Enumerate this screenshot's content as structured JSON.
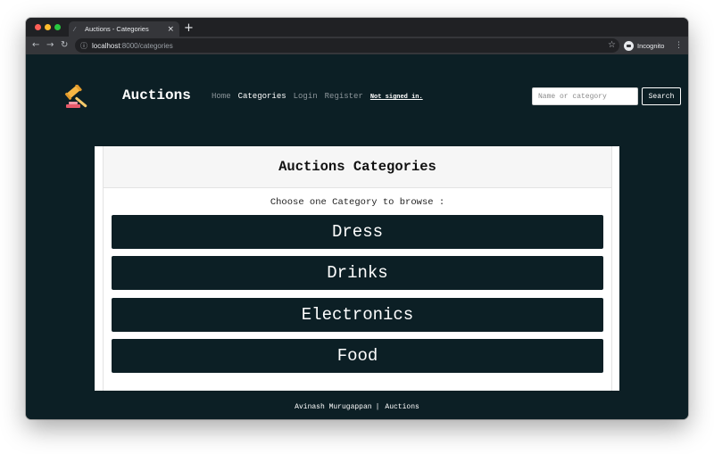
{
  "browser": {
    "tab_title": "Auctions - Categories",
    "tab_favicon": "⁄",
    "tab_close": "×",
    "new_tab": "+",
    "url_host": "localhost",
    "url_path": ":8000/categories",
    "profile_label": "Incognito"
  },
  "icons": {
    "back": "←",
    "forward": "→",
    "reload": "↻",
    "info": "ⓘ",
    "star": "☆",
    "menu": "⋮"
  },
  "header": {
    "brand": "Auctions",
    "nav": {
      "home": "Home",
      "categories": "Categories",
      "login": "Login",
      "register": "Register",
      "status": "Not signed in."
    },
    "search": {
      "placeholder": "Name or category",
      "button": "Search"
    }
  },
  "main": {
    "title": "Auctions Categories",
    "subtitle": "Choose one Category to browse :",
    "categories": [
      "Dress",
      "Drinks",
      "Electronics",
      "Food"
    ]
  },
  "footer": {
    "author": "Avinash Murugappan",
    "separator": "|",
    "brand": "Auctions"
  },
  "colors": {
    "page_bg": "#0c1f25",
    "card_bg": "#ffffff",
    "header_bg": "#f6f6f6",
    "accent": "#0c1f25"
  }
}
